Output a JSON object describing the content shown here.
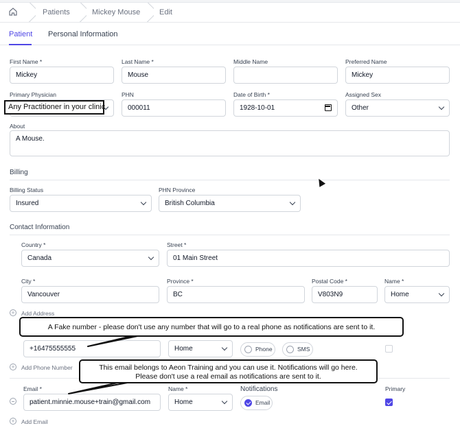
{
  "breadcrumb": {
    "items": [
      "Patients",
      "Mickey Mouse",
      "Edit"
    ]
  },
  "tabs": [
    {
      "label": "Patient",
      "active": true
    },
    {
      "label": "Personal Information",
      "active": false
    }
  ],
  "patient": {
    "first_name": {
      "label": "First Name *",
      "value": "Mickey"
    },
    "last_name": {
      "label": "Last Name *",
      "value": "Mouse"
    },
    "middle_name": {
      "label": "Middle Name",
      "value": ""
    },
    "preferred_name": {
      "label": "Preferred Name",
      "value": "Mickey"
    },
    "primary_physician": {
      "label": "Primary Physician",
      "value": "Any Practitioner in your clinic"
    },
    "phn": {
      "label": "PHN",
      "value": "000011"
    },
    "dob": {
      "label": "Date of Birth *",
      "value": "1928-10-01"
    },
    "assigned_sex": {
      "label": "Assigned Sex",
      "value": "Other"
    },
    "about": {
      "label": "About",
      "value": "A Mouse."
    }
  },
  "billing": {
    "heading": "Billing",
    "status": {
      "label": "Billing Status",
      "value": "Insured"
    },
    "province": {
      "label": "PHN Province",
      "value": "British Columbia"
    }
  },
  "contact": {
    "heading": "Contact Information",
    "country": {
      "label": "Country *",
      "value": "Canada"
    },
    "street": {
      "label": "Street *",
      "value": "01 Main Street"
    },
    "city": {
      "label": "City *",
      "value": "Vancouver"
    },
    "province": {
      "label": "Province *",
      "value": "BC"
    },
    "postal": {
      "label": "Postal Code *",
      "value": "V803N9"
    },
    "name": {
      "label": "Name *",
      "value": "Home"
    },
    "add_address": "Add Address",
    "phone": {
      "value": "+16475555555",
      "name_value": "Home",
      "opt_phone": "Phone",
      "opt_sms": "SMS"
    },
    "add_phone": "Add Phone Number",
    "email": {
      "label": "Email *",
      "value": "patient.minnie.mouse+train@gmail.com",
      "name_label": "Name *",
      "name_value": "Home",
      "notifications_label": "Notifications",
      "opt_email": "Email",
      "primary_label": "Primary"
    },
    "add_email": "Add Email"
  },
  "callouts": {
    "phone": "A Fake number - please don't use any number that will go to a real phone as notifications are sent to it.",
    "email_line1": "This email belongs to Aeon Training and you can use it.  Notifications will go here.",
    "email_line2": "Please don't use a real email as notifications are sent to it."
  },
  "colors": {
    "accent": "#4f46e5",
    "border": "#d1d5db"
  }
}
